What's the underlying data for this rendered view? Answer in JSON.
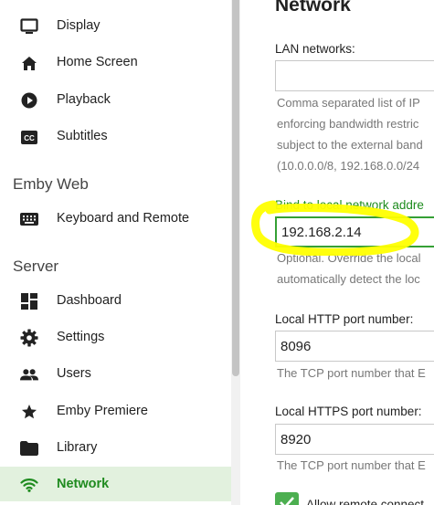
{
  "sidebar": {
    "items_top": [
      {
        "label": "Display",
        "icon": "monitor-icon"
      },
      {
        "label": "Home Screen",
        "icon": "home-icon"
      },
      {
        "label": "Playback",
        "icon": "play-circle-icon"
      },
      {
        "label": "Subtitles",
        "icon": "closed-caption-icon"
      }
    ],
    "section_web": "Emby Web",
    "items_web": [
      {
        "label": "Keyboard and Remote",
        "icon": "keyboard-icon"
      }
    ],
    "section_server": "Server",
    "items_server": [
      {
        "label": "Dashboard",
        "icon": "dashboard-icon"
      },
      {
        "label": "Settings",
        "icon": "gear-icon"
      },
      {
        "label": "Users",
        "icon": "users-icon"
      },
      {
        "label": "Emby Premiere",
        "icon": "star-icon"
      },
      {
        "label": "Library",
        "icon": "folder-icon"
      },
      {
        "label": "Network",
        "icon": "wifi-icon",
        "active": true
      }
    ]
  },
  "main": {
    "title": "Network",
    "lan": {
      "label": "LAN networks:",
      "value": "",
      "help": [
        "Comma separated list of IP",
        "enforcing bandwidth restric",
        "subject to the external band",
        "(10.0.0.0/8, 192.168.0.0/24"
      ]
    },
    "bind": {
      "label": "Bind to local network addre",
      "value": "192.168.2.14",
      "help": [
        "Optional. Override the local",
        "automatically detect the loc"
      ]
    },
    "http": {
      "label": "Local HTTP port number:",
      "value": "8096",
      "help": "The TCP port number that E"
    },
    "https": {
      "label": "Local HTTPS port number:",
      "value": "8920",
      "help": "The TCP port number that E"
    },
    "remote": {
      "label": "Allow remote connect",
      "checked": true
    }
  },
  "colors": {
    "accent": "#4caf50",
    "active_bg": "#e2f1de",
    "active_text": "#1f8b1f",
    "highlight": "#ffff00"
  }
}
